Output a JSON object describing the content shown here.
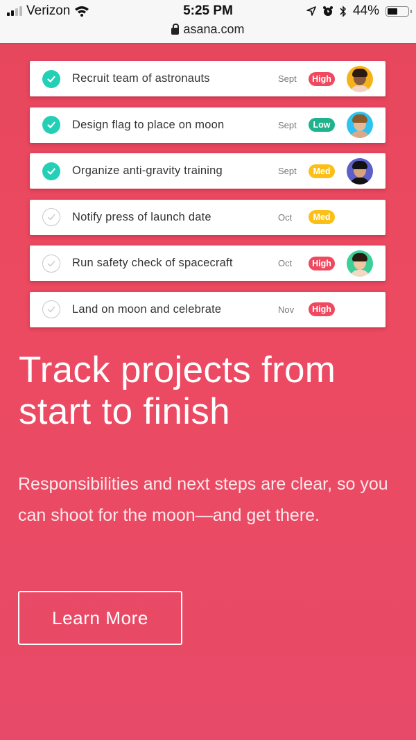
{
  "status_bar": {
    "carrier": "Verizon",
    "time": "5:25 PM",
    "battery_percent": "44%",
    "battery_level": 0.44,
    "icons": [
      "signal-icon",
      "wifi-icon",
      "location-icon",
      "alarm-icon",
      "bluetooth-icon",
      "battery-icon"
    ]
  },
  "browser": {
    "url": "asana.com",
    "secure_icon": "lock-icon"
  },
  "colors": {
    "brand_red": "#ea4760",
    "check_done": "#23d0b6",
    "priority_high": "#f0485f",
    "priority_low": "#1fb28c",
    "priority_med": "#fbbf16"
  },
  "tasks": [
    {
      "name": "Recruit team of astronauts",
      "date": "Sept",
      "priority": "High",
      "completed": true,
      "avatar": "yellow"
    },
    {
      "name": "Design flag to place on moon",
      "date": "Sept",
      "priority": "Low",
      "completed": true,
      "avatar": "blue"
    },
    {
      "name": "Organize anti-gravity training",
      "date": "Sept",
      "priority": "Med",
      "completed": true,
      "avatar": "purple"
    },
    {
      "name": "Notify press of launch date",
      "date": "Oct",
      "priority": "Med",
      "completed": false,
      "avatar": null
    },
    {
      "name": "Run safety check of spacecraft",
      "date": "Oct",
      "priority": "High",
      "completed": false,
      "avatar": "green"
    },
    {
      "name": "Land on moon and celebrate",
      "date": "Nov",
      "priority": "High",
      "completed": false,
      "avatar": null
    }
  ],
  "hero": {
    "headline": "Track projects from start to finish",
    "body": "Responsibilities and next steps are clear, so you can shoot for the moon—and get there.",
    "cta_label": "Learn More"
  }
}
